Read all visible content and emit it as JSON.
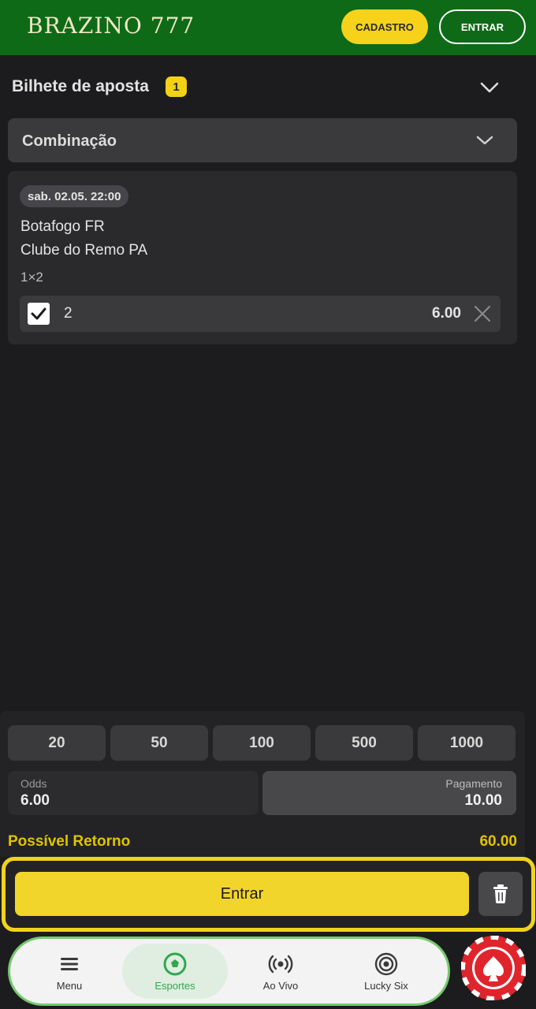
{
  "header": {
    "logo": "BRAZINO 777",
    "cadastro_label": "CADASTRO",
    "entrar_label": "ENTRAR"
  },
  "betslip": {
    "title": "Bilhete de aposta",
    "count": "1",
    "type_select": "Combinação"
  },
  "bet": {
    "datetime": "sab. 02.05. 22:00",
    "team_home": "Botafogo FR",
    "team_away": "Clube do Remo PA",
    "market": "1×2",
    "selection": "2",
    "odd": "6.00",
    "checked": true
  },
  "stake": {
    "quick_amounts": [
      "20",
      "50",
      "100",
      "500",
      "1000"
    ],
    "odds_label": "Odds",
    "odds_value": "6.00",
    "payment_label": "Pagamento",
    "payment_value": "10.00",
    "return_label": "Possível Retorno",
    "return_value": "60.00"
  },
  "actions": {
    "submit_label": "Entrar"
  },
  "nav": {
    "items": [
      {
        "label": "Menu",
        "icon": "menu-icon"
      },
      {
        "label": "Esportes",
        "icon": "soccer-ball-icon",
        "active": true
      },
      {
        "label": "Ao Vivo",
        "icon": "live-broadcast-icon"
      },
      {
        "label": "Lucky Six",
        "icon": "lucky-six-icon"
      }
    ]
  },
  "colors": {
    "header_green": "#0e6a16",
    "accent_yellow": "#f2d52a",
    "background": "#1c1c1e",
    "active_green": "#2fa84f"
  }
}
